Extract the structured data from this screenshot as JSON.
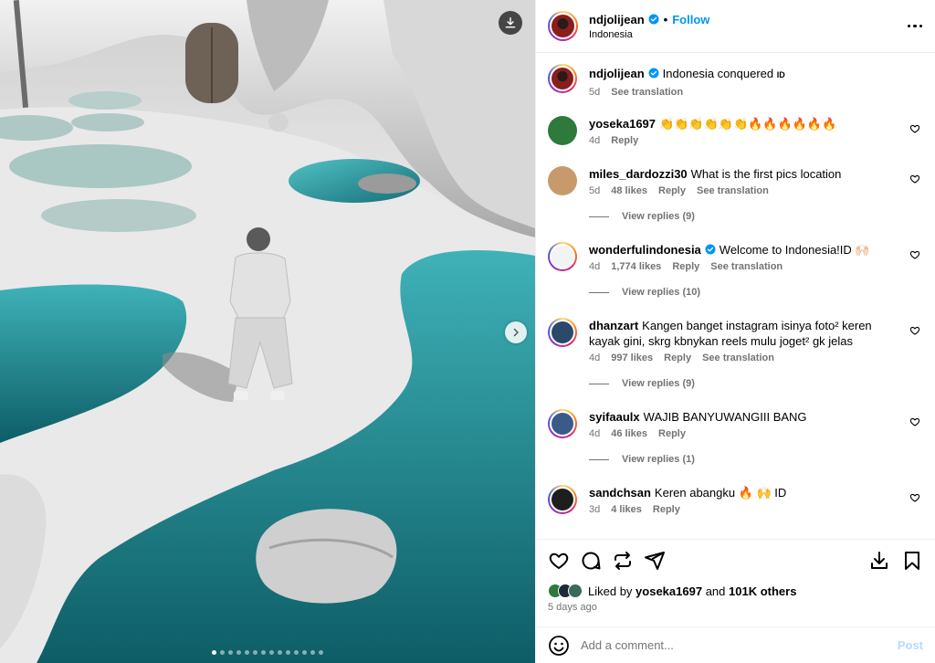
{
  "post": {
    "username": "ndjolijean",
    "follow_label": "Follow",
    "separator": "•",
    "location": "Indonesia",
    "caption": "Indonesia conquered",
    "caption_flag": "ID",
    "caption_age": "5d",
    "see_translation": "See translation",
    "carousel": {
      "count": 14,
      "active_index": 0
    }
  },
  "comments": [
    {
      "user": "yoseka1697",
      "text": "👏👏👏👏👏👏🔥🔥🔥🔥🔥🔥",
      "age": "4d",
      "likes": "",
      "reply": "Reply",
      "translate": "",
      "view_replies": "",
      "avatar_color": "#2d7a3a",
      "ring": false
    },
    {
      "user": "miles_dardozzi30",
      "text": "What is the first pics location",
      "age": "5d",
      "likes": "48 likes",
      "reply": "Reply",
      "translate": "See translation",
      "view_replies": "View replies (9)",
      "avatar_color": "#c89a6b",
      "ring": false
    },
    {
      "user": "wonderfulindonesia",
      "text": "Welcome to Indonesia!ID 🙌🏻",
      "age": "4d",
      "likes": "1,774 likes",
      "reply": "Reply",
      "translate": "See translation",
      "view_replies": "View replies (10)",
      "avatar_color": "#f3f3f3",
      "ring": true,
      "verified": true
    },
    {
      "user": "dhanzart",
      "text": "Kangen banget instagram isinya foto² keren kayak gini, skrg kbnykan reels mulu joget² gk jelas",
      "age": "4d",
      "likes": "997 likes",
      "reply": "Reply",
      "translate": "See translation",
      "view_replies": "View replies (9)",
      "avatar_color": "#2b4a6b",
      "ring": true
    },
    {
      "user": "syifaaulx",
      "text": "WAJIB BANYUWANGIII BANG",
      "age": "4d",
      "likes": "46 likes",
      "reply": "Reply",
      "translate": "",
      "view_replies": "View replies (1)",
      "avatar_color": "#3a5a8a",
      "ring": true
    },
    {
      "user": "sandchsan",
      "text": "Keren abangku 🔥 🙌 ID",
      "age": "3d",
      "likes": "4 likes",
      "reply": "Reply",
      "translate": "",
      "view_replies": "",
      "avatar_color": "#1e1e1e",
      "ring": true
    }
  ],
  "likes_line": {
    "prefix": "Liked by",
    "user": "yoseka1697",
    "and": "and",
    "others": "101K others"
  },
  "posted_ago": "5 days ago",
  "add_comment": {
    "placeholder": "Add a comment...",
    "post_label": "Post"
  },
  "colors": {
    "accent": "#0095f6",
    "verified": "#0095f6",
    "muted": "#737373",
    "water": "#2a9fa8"
  }
}
